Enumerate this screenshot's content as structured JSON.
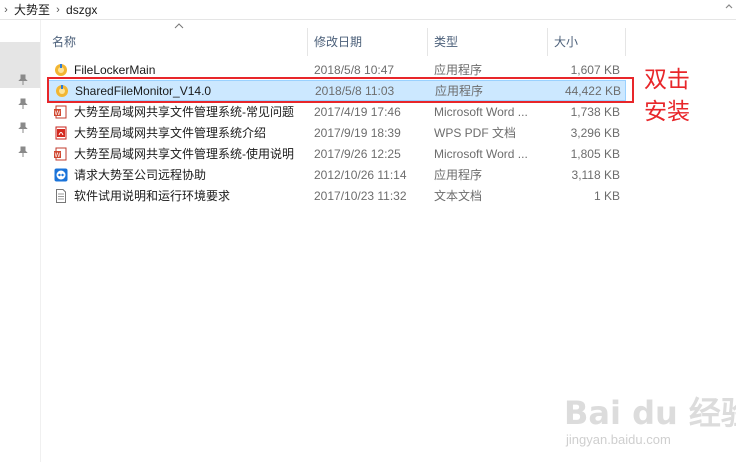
{
  "breadcrumb": {
    "items": [
      "大势至",
      "dszgx"
    ]
  },
  "columns": {
    "name": "名称",
    "date": "修改日期",
    "type": "类型",
    "size": "大小"
  },
  "files": [
    {
      "name": "FileLockerMain",
      "date": "2018/5/8 10:47",
      "type": "应用程序",
      "size": "1,607 KB",
      "icon": "app-icon",
      "selected": false
    },
    {
      "name": "SharedFileMonitor_V14.0",
      "date": "2018/5/8 11:03",
      "type": "应用程序",
      "size": "44,422 KB",
      "icon": "app-icon",
      "selected": true
    },
    {
      "name": "大势至局域网共享文件管理系统-常见问题",
      "date": "2017/4/19 17:46",
      "type": "Microsoft Word ...",
      "size": "1,738 KB",
      "icon": "word-doc-icon",
      "selected": false
    },
    {
      "name": "大势至局域网共享文件管理系统介绍",
      "date": "2017/9/19 18:39",
      "type": "WPS PDF 文档",
      "size": "3,296 KB",
      "icon": "pdf-icon",
      "selected": false
    },
    {
      "name": "大势至局域网共享文件管理系统-使用说明",
      "date": "2017/9/26 12:25",
      "type": "Microsoft Word ...",
      "size": "1,805 KB",
      "icon": "word-doc-icon",
      "selected": false
    },
    {
      "name": "请求大势至公司远程协助",
      "date": "2012/10/26 11:14",
      "type": "应用程序",
      "size": "3,118 KB",
      "icon": "teamviewer-icon",
      "selected": false
    },
    {
      "name": "软件试用说明和运行环境要求",
      "date": "2017/10/23 11:32",
      "type": "文本文档",
      "size": "1 KB",
      "icon": "text-file-icon",
      "selected": false
    }
  ],
  "annotation": {
    "line1": "双击",
    "line2": "安装"
  },
  "watermark": {
    "main": "Bai du 经验",
    "url": "jingyan.baidu.com"
  },
  "colors": {
    "selection": "#cce8ff",
    "annotation": "#e8262a",
    "header_text": "#4c607a"
  }
}
